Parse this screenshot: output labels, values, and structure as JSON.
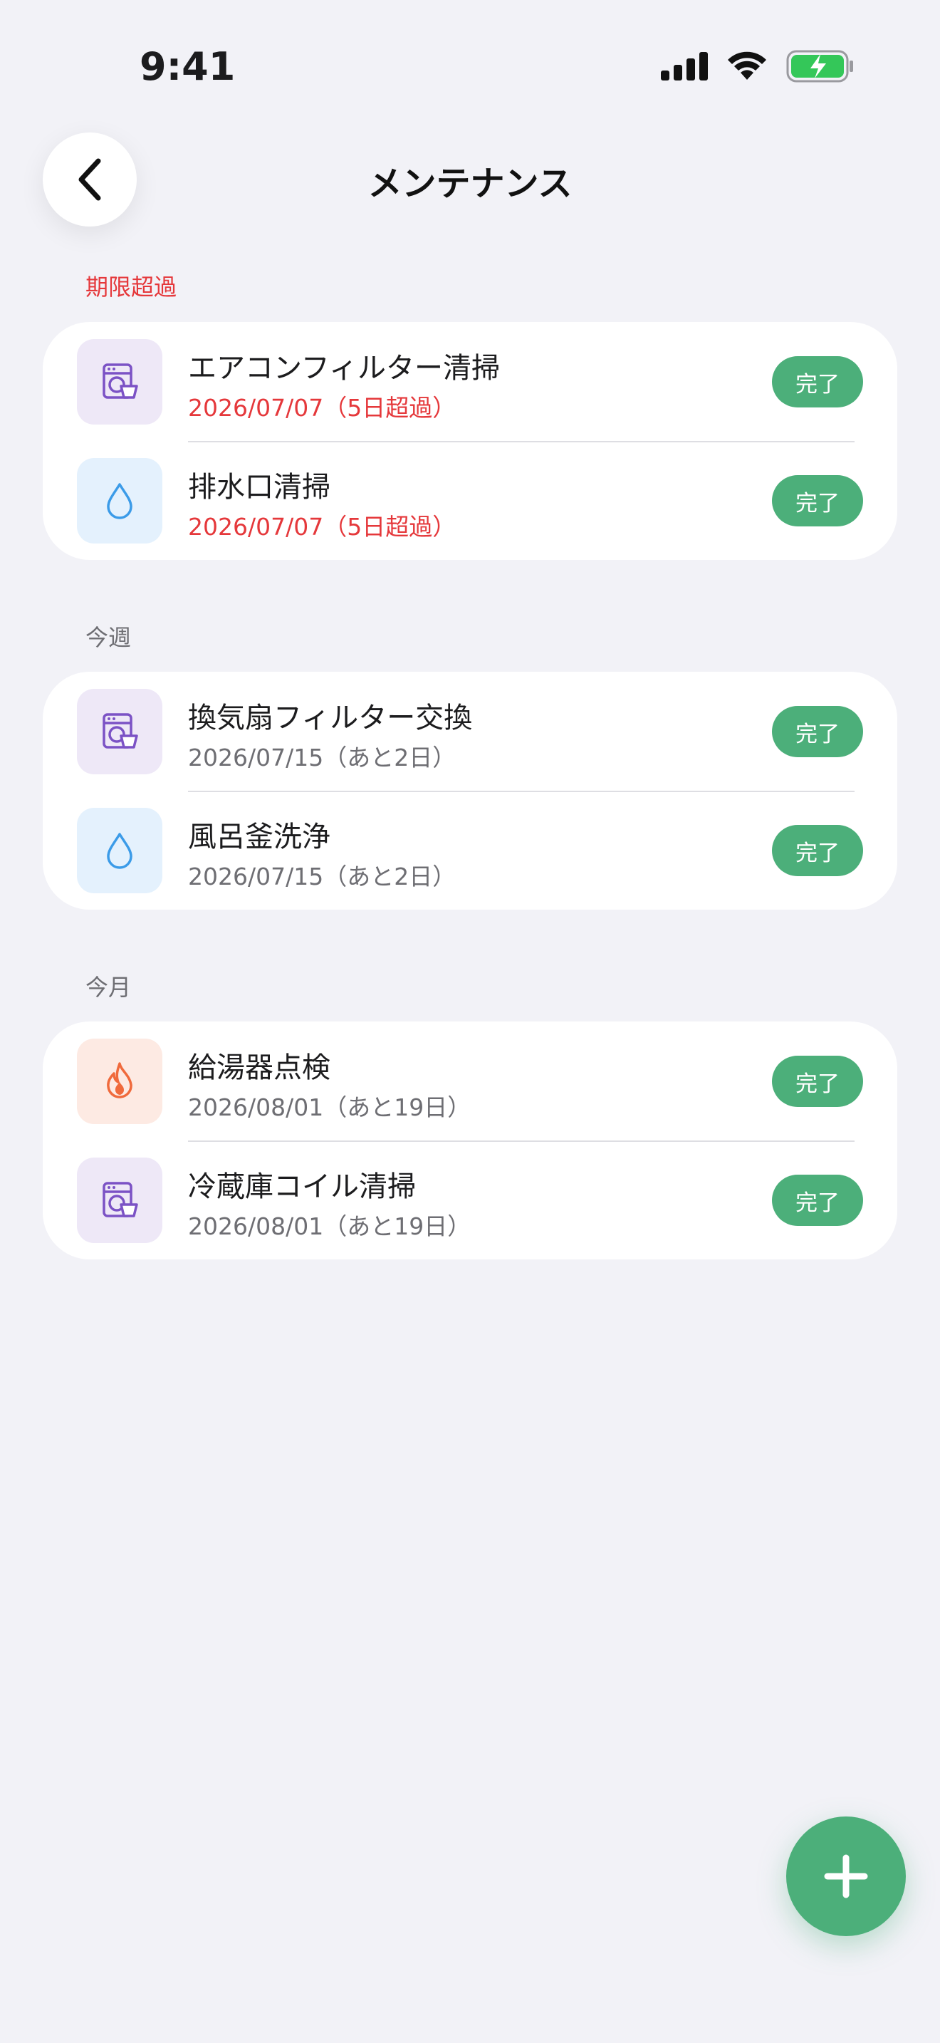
{
  "status_bar": {
    "time": "9:41"
  },
  "header": {
    "title": "メンテナンス"
  },
  "sections": [
    {
      "label": "期限超過",
      "items": [
        {
          "title": "エアコンフィルター清掃",
          "date": "2026/07/07（5日超過）",
          "icon": "washing-machine-icon",
          "done_label": "完了"
        },
        {
          "title": "排水口清掃",
          "date": "2026/07/07（5日超過）",
          "icon": "water-drop-icon",
          "done_label": "完了"
        }
      ]
    },
    {
      "label": "今週",
      "items": [
        {
          "title": "換気扇フィルター交換",
          "date": "2026/07/15（あと2日）",
          "icon": "washing-machine-icon",
          "done_label": "完了"
        },
        {
          "title": "風呂釜洗浄",
          "date": "2026/07/15（あと2日）",
          "icon": "water-drop-icon",
          "done_label": "完了"
        }
      ]
    },
    {
      "label": "今月",
      "items": [
        {
          "title": "給湯器点検",
          "date": "2026/08/01（あと19日）",
          "icon": "flame-icon",
          "done_label": "完了"
        },
        {
          "title": "冷蔵庫コイル清掃",
          "date": "2026/08/01（あと19日）",
          "icon": "washing-machine-icon",
          "done_label": "完了"
        }
      ]
    }
  ],
  "colors": {
    "accent": "#4caf7a",
    "overdue": "#e5383b",
    "background": "#f2f2f7"
  }
}
